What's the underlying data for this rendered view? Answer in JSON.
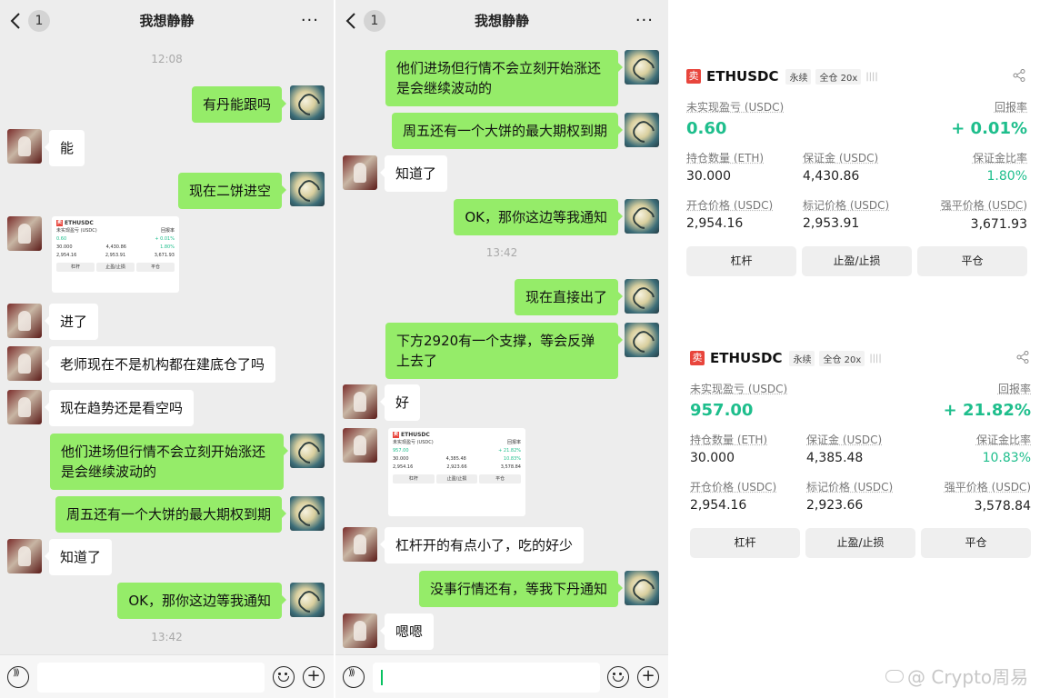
{
  "chat": {
    "title": "我想静静",
    "unread": "1",
    "more": "···",
    "plus": "+"
  },
  "left": {
    "time1": "12:08",
    "time2": "13:42",
    "m1": "有丹能跟吗",
    "m2": "能",
    "m3": "现在二饼进空",
    "m4": "进了",
    "m5": "老师现在不是机构都在建底仓了吗",
    "m6": "现在趋势还是看空吗",
    "m7": "他们进场但行情不会立刻开始涨还是会继续波动的",
    "m8": "周五还有一个大饼的最大期权到期",
    "m9": "知道了",
    "m10": "OK，那你这边等我通知"
  },
  "right": {
    "time1": "13:42",
    "m1": "他们进场但行情不会立刻开始涨还是会继续波动的",
    "m2": "周五还有一个大饼的最大期权到期",
    "m3": "知道了",
    "m4": "OK，那你这边等我通知",
    "m5": "现在直接出了",
    "m6": "下方2920有一个支撑，等会反弹上去了",
    "m7": "好",
    "m8": "杠杆开的有点小了，吃的好少",
    "m9": "没事行情还有，等我下丹通知",
    "m10": "嗯嗯"
  },
  "card_common": {
    "side": "卖",
    "symbol": "ETHUSDC",
    "perp": "永续",
    "margin_mode": "全仓 20x",
    "bars": "||||",
    "lbl_pnl": "未实现盈亏 (USDC)",
    "lbl_roi": "回报率",
    "lbl_size": "持仓数量 (ETH)",
    "lbl_margin": "保证金 (USDC)",
    "lbl_margin_ratio": "保证金比率",
    "lbl_entry": "开仓价格 (USDC)",
    "lbl_mark": "标记价格 (USDC)",
    "lbl_liq": "强平价格 (USDC)",
    "btn_leverage": "杠杆",
    "btn_tpsl": "止盈/止损",
    "btn_close": "平仓"
  },
  "card1": {
    "pnl": "0.60",
    "roi": "+ 0.01%",
    "size": "30.000",
    "margin": "4,430.86",
    "margin_ratio": "1.80%",
    "entry": "2,954.16",
    "mark": "2,953.91",
    "liq": "3,671.93"
  },
  "card2": {
    "pnl": "957.00",
    "roi": "+ 21.82%",
    "size": "30.000",
    "margin": "4,385.48",
    "margin_ratio": "10.83%",
    "entry": "2,954.16",
    "mark": "2,923.66",
    "liq": "3,578.84"
  },
  "watermark": "@ Crypto周易"
}
